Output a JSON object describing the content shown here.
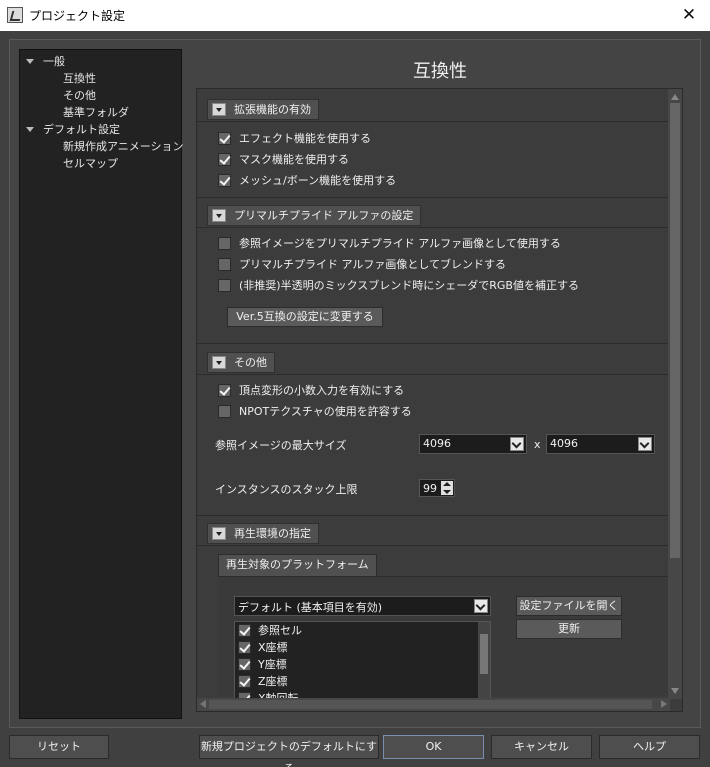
{
  "window": {
    "title": "プロジェクト設定",
    "close_glyph": "✕"
  },
  "tree": {
    "items": [
      {
        "label": "一般",
        "level": 0,
        "expanded": true
      },
      {
        "label": "互換性",
        "level": 1
      },
      {
        "label": "その他",
        "level": 1
      },
      {
        "label": "基準フォルダ",
        "level": 1
      },
      {
        "label": "デフォルト設定",
        "level": 0,
        "expanded": true
      },
      {
        "label": "新規作成アニメーション",
        "level": 1
      },
      {
        "label": "セルマップ",
        "level": 1
      }
    ]
  },
  "page_title": "互換性",
  "sections": {
    "ext": {
      "title": "拡張機能の有効",
      "items": [
        {
          "label": "エフェクト機能を使用する",
          "checked": true
        },
        {
          "label": "マスク機能を使用する",
          "checked": true
        },
        {
          "label": "メッシュ/ボーン機能を使用する",
          "checked": true
        }
      ]
    },
    "premul": {
      "title": "プリマルチプライド アルファの設定",
      "items": [
        {
          "label": "参照イメージをプリマルチプライド アルファ画像として使用する",
          "checked": false
        },
        {
          "label": "プリマルチプライド アルファ画像としてブレンドする",
          "checked": false
        },
        {
          "label": "(非推奨)半透明のミックスブレンド時にシェーダでRGB値を補正する",
          "checked": false
        }
      ],
      "v5_button": "Ver.5互換の設定に変更する"
    },
    "other": {
      "title": "その他",
      "items": [
        {
          "label": "頂点変形の小数入力を有効にする",
          "checked": true
        },
        {
          "label": "NPOTテクスチャの使用を許容する",
          "checked": false
        }
      ],
      "max_size_label": "参照イメージの最大サイズ",
      "max_w": "4096",
      "times": "x",
      "max_h": "4096",
      "instance_label": "インスタンスのスタック上限",
      "instance_value": "99"
    },
    "playback": {
      "title": "再生環境の指定",
      "subtab": "再生対象のプラットフォーム",
      "platform_select": "デフォルト (基本項目を有効)",
      "open_button": "設定ファイルを開く",
      "update_button": "更新",
      "list": [
        {
          "label": "参照セル",
          "checked": true
        },
        {
          "label": "X座標",
          "checked": true
        },
        {
          "label": "Y座標",
          "checked": true
        },
        {
          "label": "Z座標",
          "checked": true
        },
        {
          "label": "X軸回転",
          "checked": true
        }
      ]
    }
  },
  "footer": {
    "reset": "リセット",
    "set_default": "新規プロジェクトのデフォルトにする",
    "ok": "OK",
    "cancel": "キャンセル",
    "help": "ヘルプ"
  }
}
